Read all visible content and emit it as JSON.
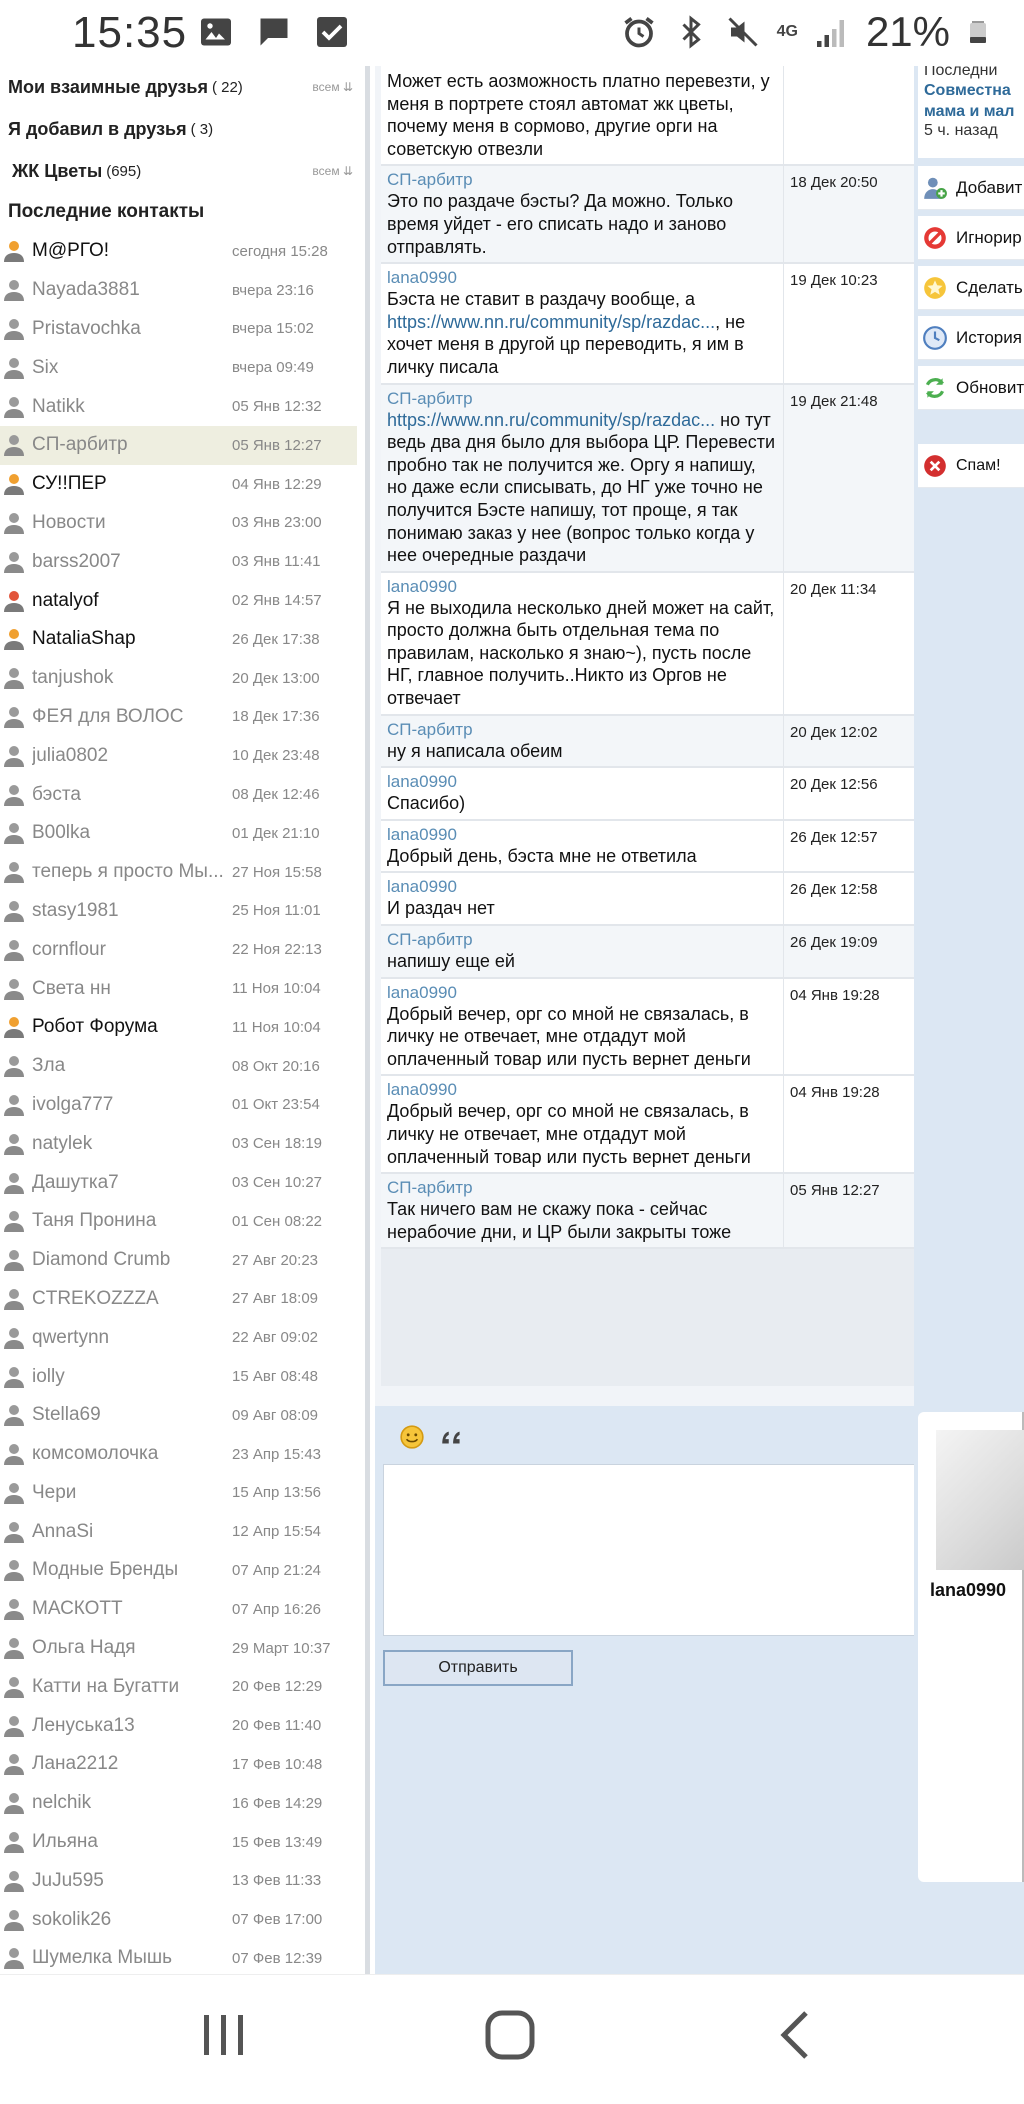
{
  "status_bar": {
    "time": "15:35",
    "network": "4G",
    "battery": "21%"
  },
  "groups": [
    {
      "label": "Мои взаимные друзья",
      "count": "( 22)",
      "all": "всем"
    },
    {
      "label": "Я добавил в друзья",
      "count": "( 3)",
      "all": ""
    },
    {
      "label": "ЖК Цветы",
      "count": "(695)",
      "all": "всем"
    }
  ],
  "recent_title": "Последние контакты",
  "contacts": [
    {
      "name": "М@РГО!",
      "time": "сегодня 15:28",
      "status": "online-orange"
    },
    {
      "name": "Nayada3881",
      "time": "вчера 23:16",
      "status": "offline"
    },
    {
      "name": "Pristavochka",
      "time": "вчера 15:02",
      "status": "offline"
    },
    {
      "name": "Six",
      "time": "вчера 09:49",
      "status": "offline"
    },
    {
      "name": "Natikk",
      "time": "05 Янв 12:32",
      "status": "offline"
    },
    {
      "name": "СП-арбитр",
      "time": "05 Янв 12:27",
      "status": "offline"
    },
    {
      "name": "СУ!!ПЕР",
      "time": "04 Янв 12:29",
      "status": "online-orange"
    },
    {
      "name": "Новости",
      "time": "03 Янв 23:00",
      "status": "offline"
    },
    {
      "name": "barss2007",
      "time": "03 Янв 11:41",
      "status": "offline"
    },
    {
      "name": "natalyof",
      "time": "02 Янв 14:57",
      "status": "online-red"
    },
    {
      "name": "NataliaShap",
      "time": "26 Дек 17:38",
      "status": "online-orange"
    },
    {
      "name": "tanjushok",
      "time": "20 Дек 13:00",
      "status": "offline"
    },
    {
      "name": "ФЕЯ для ВОЛОС",
      "time": "18 Дек 17:36",
      "status": "offline"
    },
    {
      "name": "julia0802",
      "time": "10 Дек 23:48",
      "status": "offline"
    },
    {
      "name": "бэста",
      "time": "08 Дек 12:46",
      "status": "offline"
    },
    {
      "name": "B00lka",
      "time": "01 Дек 21:10",
      "status": "offline"
    },
    {
      "name": "теперь я просто Мы...",
      "time": "27 Ноя 15:58",
      "status": "offline"
    },
    {
      "name": "stasy1981",
      "time": "25 Ноя 11:01",
      "status": "offline"
    },
    {
      "name": "cornflour",
      "time": "22 Ноя 22:13",
      "status": "offline"
    },
    {
      "name": "Света нн",
      "time": "11 Ноя 10:04",
      "status": "offline"
    },
    {
      "name": "Робот Форума",
      "time": "11 Ноя 10:04",
      "status": "online-orange"
    },
    {
      "name": "Зла",
      "time": "08 Окт 20:16",
      "status": "offline"
    },
    {
      "name": "ivolga777",
      "time": "01 Окт 23:54",
      "status": "offline"
    },
    {
      "name": "natylek",
      "time": "03 Сен 18:19",
      "status": "offline"
    },
    {
      "name": "Дашутка7",
      "time": "03 Сен 10:27",
      "status": "offline"
    },
    {
      "name": "Таня Пронина",
      "time": "01 Сен 08:22",
      "status": "offline"
    },
    {
      "name": "Diamond Crumb",
      "time": "27 Авг 20:23",
      "status": "offline"
    },
    {
      "name": "CTREKOZZZA",
      "time": "27 Авг 18:09",
      "status": "offline"
    },
    {
      "name": "qwertynn",
      "time": "22 Авг 09:02",
      "status": "offline"
    },
    {
      "name": "iolly",
      "time": "15 Авг 08:48",
      "status": "offline"
    },
    {
      "name": "Stella69",
      "time": "09 Авг 08:09",
      "status": "offline"
    },
    {
      "name": "комсомолочка",
      "time": "23 Апр 15:43",
      "status": "offline"
    },
    {
      "name": "Чери",
      "time": "15 Апр 13:56",
      "status": "offline"
    },
    {
      "name": "AnnaSi",
      "time": "12 Апр 15:54",
      "status": "offline"
    },
    {
      "name": "Модные Бренды",
      "time": "07 Апр 21:24",
      "status": "offline"
    },
    {
      "name": "МАСКОТТ",
      "time": "07 Апр 16:26",
      "status": "offline"
    },
    {
      "name": "Ольга Надя",
      "time": "29 Март 10:37",
      "status": "offline"
    },
    {
      "name": "Катти на Бугатти",
      "time": "20 Фев 12:29",
      "status": "offline"
    },
    {
      "name": "Ленуська13",
      "time": "20 Фев 11:40",
      "status": "offline"
    },
    {
      "name": "Лана2212",
      "time": "17 Фев 10:48",
      "status": "offline"
    },
    {
      "name": "nelchik",
      "time": "16 Фев 14:29",
      "status": "offline"
    },
    {
      "name": "Ильяна",
      "time": "15 Фев 13:49",
      "status": "offline"
    },
    {
      "name": "JuJu595",
      "time": "13 Фев 11:33",
      "status": "offline"
    },
    {
      "name": "sokolik26",
      "time": "07 Фев 17:00",
      "status": "offline"
    },
    {
      "name": "Шумелка Мышь",
      "time": "07 Фев 12:39",
      "status": "offline"
    }
  ],
  "messages": [
    {
      "author": "",
      "date": "",
      "alt": false,
      "text_before": "Может есть аозможность платно перевезти, у меня в портрете стоял автомат жк цветы, почему меня в сормово, другие орги на советскую отвезли",
      "link": "",
      "text_after": ""
    },
    {
      "author": "СП-арбитр",
      "date": "18 Дек 20:50",
      "alt": true,
      "text_before": "Это по раздаче бэсты? Да можно. Только время уйдет - его списать надо и заново отправлять.",
      "link": "",
      "text_after": ""
    },
    {
      "author": "lana0990",
      "date": "19 Дек 10:23",
      "alt": false,
      "text_before": "Бэста не ставит в раздачу вообще, а ",
      "link": "https://www.nn.ru/community/sp/razdac...",
      "text_after": ", не хочет меня в другой цр переводить, я им в личку писала"
    },
    {
      "author": "СП-арбитр",
      "date": "19 Дек 21:48",
      "alt": true,
      "text_before": "",
      "link": "https://www.nn.ru/community/sp/razdac...",
      "text_after": " но тут ведь два дня было для выбора ЦР. Перевести пробно так не получится же. Оргу я напишу, но даже если списывать, до НГ уже точно не получится Бэсте напишу, тот проще, я так понимаю заказ у нее (вопрос только когда у нее очередные раздачи"
    },
    {
      "author": "lana0990",
      "date": "20 Дек 11:34",
      "alt": false,
      "text_before": "Я не выходила несколько дней может на сайт, просто должна быть отдельная тема по правилам, насколько я знаю~), пусть после НГ, главное получить..Никто из Оргов не отвечает",
      "link": "",
      "text_after": ""
    },
    {
      "author": "СП-арбитр",
      "date": "20 Дек 12:02",
      "alt": true,
      "text_before": "ну я написала обеим",
      "link": "",
      "text_after": ""
    },
    {
      "author": "lana0990",
      "date": "20 Дек 12:56",
      "alt": false,
      "text_before": "Спасибо)",
      "link": "",
      "text_after": ""
    },
    {
      "author": "lana0990",
      "date": "26 Дек 12:57",
      "alt": false,
      "text_before": "Добрый день, бэста мне не ответила",
      "link": "",
      "text_after": ""
    },
    {
      "author": "lana0990",
      "date": "26 Дек 12:58",
      "alt": false,
      "text_before": "И раздач нет",
      "link": "",
      "text_after": ""
    },
    {
      "author": "СП-арбитр",
      "date": "26 Дек 19:09",
      "alt": true,
      "text_before": "напишу еще ей",
      "link": "",
      "text_after": ""
    },
    {
      "author": "lana0990",
      "date": "04 Янв 19:28",
      "alt": false,
      "text_before": "Добрый вечер, орг со мной не связалась, в личку не отвечает, мне отдадут мой оплаченный товар или пусть вернет деньги",
      "link": "",
      "text_after": ""
    },
    {
      "author": "lana0990",
      "date": "04 Янв 19:28",
      "alt": false,
      "text_before": "Добрый вечер, орг со мной не связалась, в личку не отвечает, мне отдадут мой оплаченный товар или пусть вернет деньги",
      "link": "",
      "text_after": ""
    },
    {
      "author": "СП-арбитр",
      "date": "05 Янв 12:27",
      "alt": true,
      "text_before": "Так ничего вам не скажу пока - сейчас нерабочие дни, и ЦР были закрыты тоже",
      "link": "",
      "text_after": ""
    }
  ],
  "composer": {
    "send_label": "Отправить"
  },
  "right": {
    "recent_label": "Последни",
    "group_title_1": "Совместна",
    "group_title_2": "мама и мал",
    "group_time": "5 ч. назад",
    "actions": [
      {
        "label": "Добавит",
        "icon": "add-friend-icon"
      },
      {
        "label": "Игнорир",
        "icon": "ignore-icon"
      },
      {
        "label": "Сделать",
        "icon": "star-icon"
      },
      {
        "label": "История",
        "icon": "history-icon"
      },
      {
        "label": "Обновит",
        "icon": "refresh-icon"
      },
      {
        "label": "Спам!",
        "icon": "spam-icon"
      }
    ],
    "profile_name": "lana0990"
  },
  "colors": {
    "link": "#2e6a99",
    "author": "#5a8db5",
    "panel_bg": "#dce7f3",
    "active_row": "#eeeee0"
  }
}
